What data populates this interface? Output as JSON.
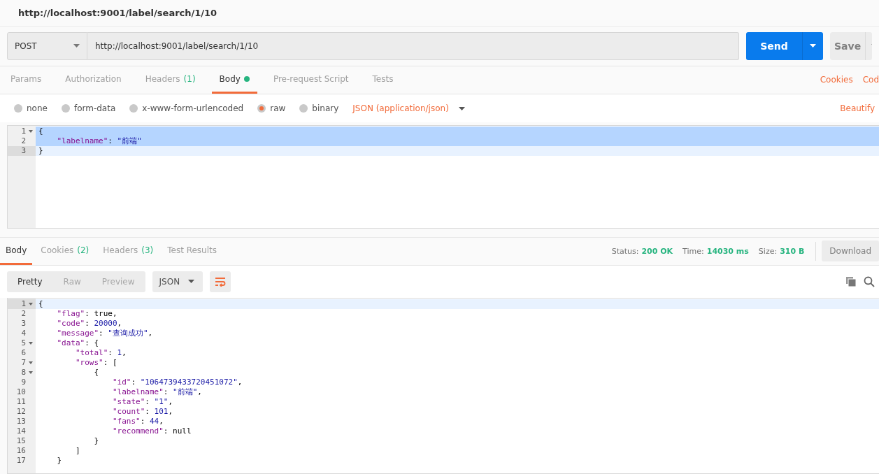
{
  "tab_title": "http://localhost:9001/label/search/1/10",
  "request": {
    "method": "POST",
    "url": "http://localhost:9001/label/search/1/10",
    "send_label": "Send",
    "save_label": "Save"
  },
  "request_tabs": [
    {
      "label": "Params",
      "selected": false,
      "dot": false
    },
    {
      "label": "Authorization",
      "selected": false,
      "dot": false
    },
    {
      "label": "Headers",
      "count": "(1)",
      "selected": false,
      "dot": false
    },
    {
      "label": "Body",
      "selected": true,
      "dot": true
    },
    {
      "label": "Pre-request Script",
      "selected": false,
      "dot": false
    },
    {
      "label": "Tests",
      "selected": false,
      "dot": false
    }
  ],
  "request_links": [
    "Cookies",
    "Cod"
  ],
  "body_types": [
    {
      "label": "none",
      "selected": false
    },
    {
      "label": "form-data",
      "selected": false
    },
    {
      "label": "x-www-form-urlencoded",
      "selected": false
    },
    {
      "label": "raw",
      "selected": true
    },
    {
      "label": "binary",
      "selected": false
    }
  ],
  "content_type": "JSON (application/json)",
  "beautify": "Beautify",
  "request_body": [
    {
      "number": "1",
      "foldable": true,
      "selected": true,
      "active": false,
      "tokens": [
        {
          "kind": "punct",
          "text": "{"
        }
      ]
    },
    {
      "number": "2",
      "foldable": false,
      "selected": true,
      "active": false,
      "tokens": [
        {
          "kind": "key",
          "text": "    \"labelname\""
        },
        {
          "kind": "punct",
          "text": ": "
        },
        {
          "kind": "string",
          "text": "\"前端\""
        }
      ]
    },
    {
      "number": "3",
      "foldable": false,
      "selected": false,
      "active": true,
      "tokens": [
        {
          "kind": "punct",
          "text": "}"
        }
      ]
    }
  ],
  "response_tabs": [
    {
      "label": "Body",
      "selected": true
    },
    {
      "label": "Cookies",
      "count": "(2)",
      "selected": false
    },
    {
      "label": "Headers",
      "count": "(3)",
      "selected": false
    },
    {
      "label": "Test Results",
      "selected": false
    }
  ],
  "status": [
    {
      "label": "Status:",
      "value": "200 OK"
    },
    {
      "label": "Time:",
      "value": "14030 ms"
    },
    {
      "label": "Size:",
      "value": "310 B"
    }
  ],
  "download": "Download",
  "view_modes": [
    {
      "label": "Pretty",
      "selected": true
    },
    {
      "label": "Raw",
      "selected": false
    },
    {
      "label": "Preview",
      "selected": false
    }
  ],
  "format": "JSON",
  "wrap": true,
  "response_body": [
    {
      "number": "1",
      "foldable": true,
      "active": true,
      "tokens": [
        {
          "kind": "punct",
          "text": "{"
        }
      ]
    },
    {
      "number": "2",
      "foldable": false,
      "active": false,
      "tokens": [
        {
          "kind": "key",
          "text": "    \"flag\""
        },
        {
          "kind": "punct",
          "text": ": "
        },
        {
          "kind": "literal",
          "text": "true"
        },
        {
          "kind": "punct",
          "text": ","
        }
      ]
    },
    {
      "number": "3",
      "foldable": false,
      "active": false,
      "tokens": [
        {
          "kind": "key",
          "text": "    \"code\""
        },
        {
          "kind": "punct",
          "text": ": "
        },
        {
          "kind": "number",
          "text": "20000"
        },
        {
          "kind": "punct",
          "text": ","
        }
      ]
    },
    {
      "number": "4",
      "foldable": false,
      "active": false,
      "tokens": [
        {
          "kind": "key",
          "text": "    \"message\""
        },
        {
          "kind": "punct",
          "text": ": "
        },
        {
          "kind": "string",
          "text": "\"查询成功\""
        },
        {
          "kind": "punct",
          "text": ","
        }
      ]
    },
    {
      "number": "5",
      "foldable": true,
      "active": false,
      "tokens": [
        {
          "kind": "key",
          "text": "    \"data\""
        },
        {
          "kind": "punct",
          "text": ": {"
        }
      ]
    },
    {
      "number": "6",
      "foldable": false,
      "active": false,
      "tokens": [
        {
          "kind": "key",
          "text": "        \"total\""
        },
        {
          "kind": "punct",
          "text": ": "
        },
        {
          "kind": "number",
          "text": "1"
        },
        {
          "kind": "punct",
          "text": ","
        }
      ]
    },
    {
      "number": "7",
      "foldable": true,
      "active": false,
      "tokens": [
        {
          "kind": "key",
          "text": "        \"rows\""
        },
        {
          "kind": "punct",
          "text": ": ["
        }
      ]
    },
    {
      "number": "8",
      "foldable": true,
      "active": false,
      "tokens": [
        {
          "kind": "punct",
          "text": "            {"
        }
      ]
    },
    {
      "number": "9",
      "foldable": false,
      "active": false,
      "tokens": [
        {
          "kind": "key",
          "text": "                \"id\""
        },
        {
          "kind": "punct",
          "text": ": "
        },
        {
          "kind": "string",
          "text": "\"1064739433720451072\""
        },
        {
          "kind": "punct",
          "text": ","
        }
      ]
    },
    {
      "number": "10",
      "foldable": false,
      "active": false,
      "tokens": [
        {
          "kind": "key",
          "text": "                \"labelname\""
        },
        {
          "kind": "punct",
          "text": ": "
        },
        {
          "kind": "string",
          "text": "\"前端\""
        },
        {
          "kind": "punct",
          "text": ","
        }
      ]
    },
    {
      "number": "11",
      "foldable": false,
      "active": false,
      "tokens": [
        {
          "kind": "key",
          "text": "                \"state\""
        },
        {
          "kind": "punct",
          "text": ": "
        },
        {
          "kind": "string",
          "text": "\"1\""
        },
        {
          "kind": "punct",
          "text": ","
        }
      ]
    },
    {
      "number": "12",
      "foldable": false,
      "active": false,
      "tokens": [
        {
          "kind": "key",
          "text": "                \"count\""
        },
        {
          "kind": "punct",
          "text": ": "
        },
        {
          "kind": "number",
          "text": "101"
        },
        {
          "kind": "punct",
          "text": ","
        }
      ]
    },
    {
      "number": "13",
      "foldable": false,
      "active": false,
      "tokens": [
        {
          "kind": "key",
          "text": "                \"fans\""
        },
        {
          "kind": "punct",
          "text": ": "
        },
        {
          "kind": "number",
          "text": "44"
        },
        {
          "kind": "punct",
          "text": ","
        }
      ]
    },
    {
      "number": "14",
      "foldable": false,
      "active": false,
      "tokens": [
        {
          "kind": "key",
          "text": "                \"recommend\""
        },
        {
          "kind": "punct",
          "text": ": "
        },
        {
          "kind": "literal",
          "text": "null"
        }
      ]
    },
    {
      "number": "15",
      "foldable": false,
      "active": false,
      "tokens": [
        {
          "kind": "punct",
          "text": "            }"
        }
      ]
    },
    {
      "number": "16",
      "foldable": false,
      "active": false,
      "tokens": [
        {
          "kind": "punct",
          "text": "        ]"
        }
      ]
    },
    {
      "number": "17",
      "foldable": false,
      "active": false,
      "tokens": [
        {
          "kind": "punct",
          "text": "    }"
        }
      ]
    }
  ]
}
